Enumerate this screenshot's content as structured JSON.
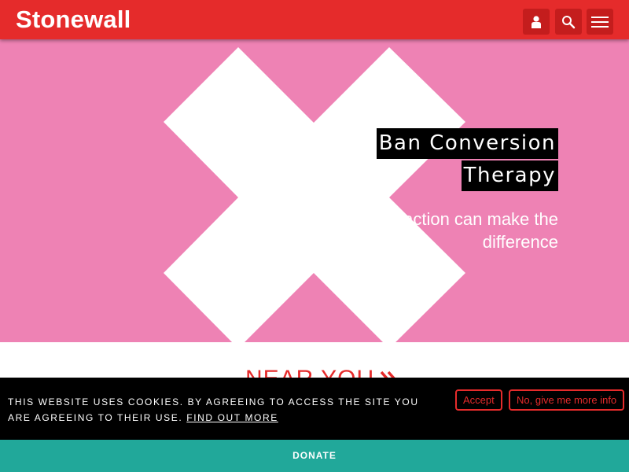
{
  "header": {
    "logo_text": "Stonewall",
    "icons": [
      "user-icon",
      "search-icon",
      "menu-icon"
    ],
    "colors": {
      "bar": "#e52b2b",
      "button": "#c41d1d"
    }
  },
  "hero": {
    "title_line1": "Ban Conversion",
    "title_line2": "Therapy",
    "subtitle_line1": "action can make the",
    "subtitle_line2": "difference",
    "background": "#ee82b4"
  },
  "section": {
    "heading": "NEAR YOU",
    "icon": "double-chevron-right-icon"
  },
  "cookie_banner": {
    "text": "THIS WEBSITE USES COOKIES. BY AGREEING TO ACCESS THE SITE YOU ARE AGREEING TO THEIR USE.",
    "link": "FIND OUT MORE",
    "accept_label": "Accept",
    "more_info_label": "No, give me more info"
  },
  "footer": {
    "donate_label": "DONATE",
    "color": "#21a89a"
  }
}
